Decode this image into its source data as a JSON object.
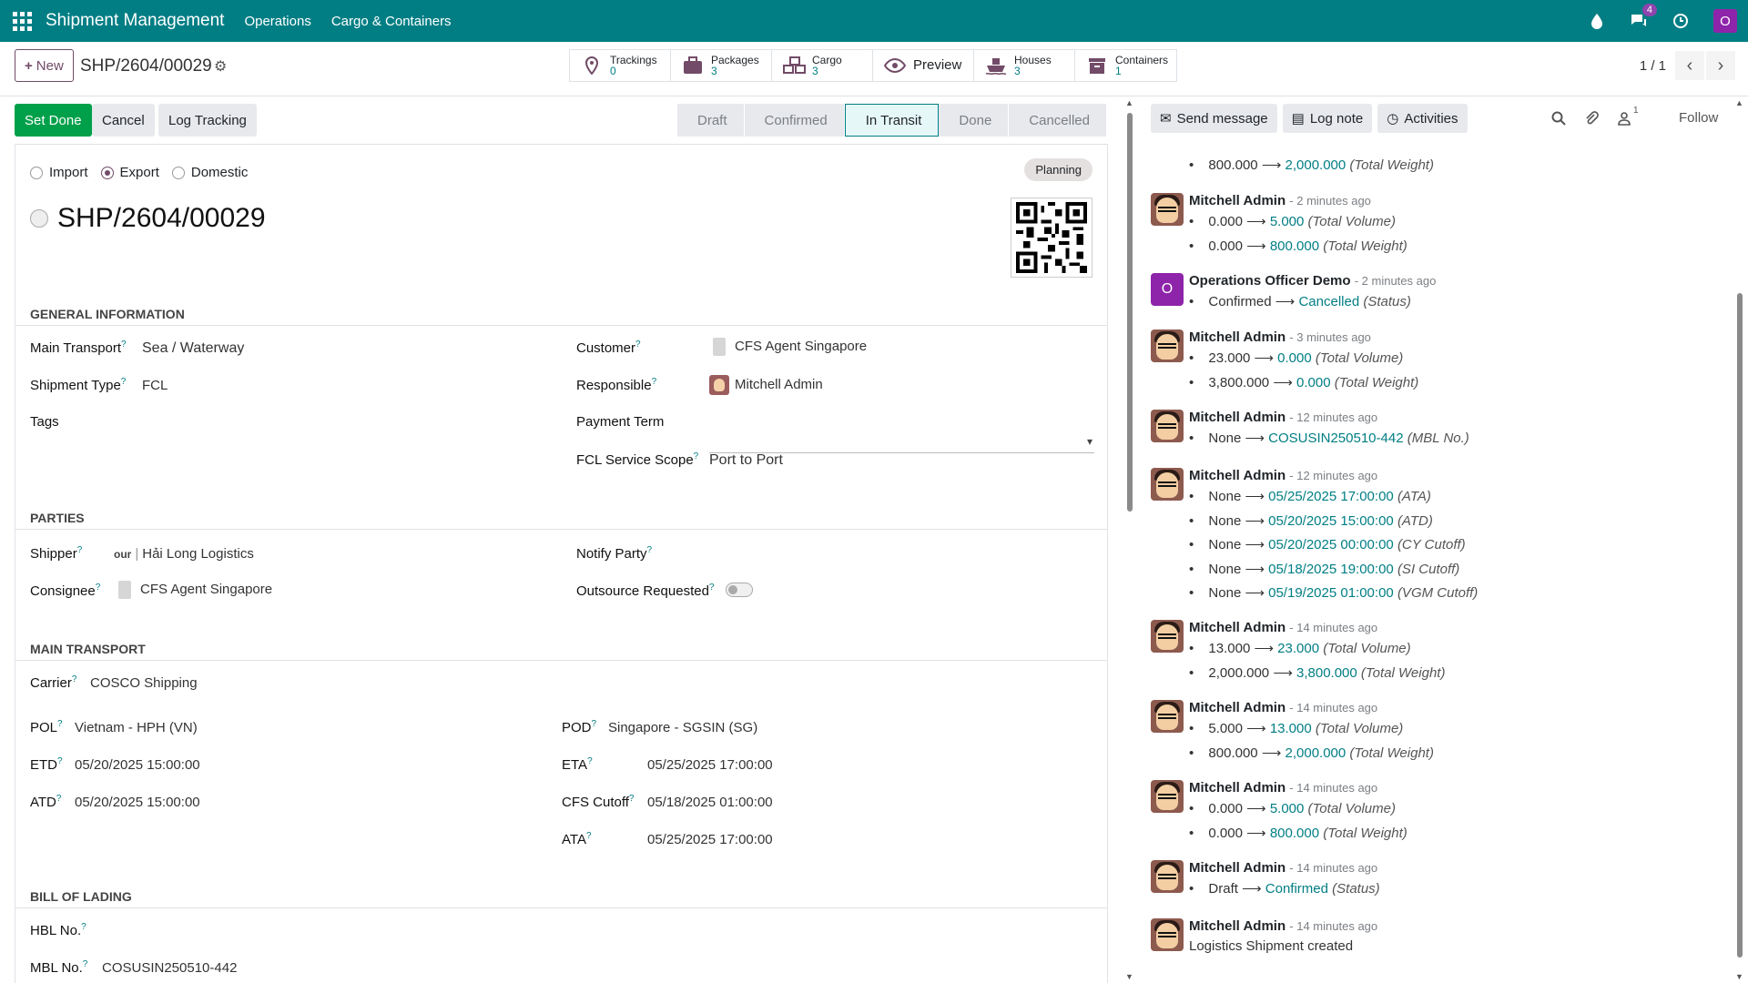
{
  "nav": {
    "brand": "Shipment Management",
    "menus": [
      "Operations",
      "Cargo & Containers"
    ],
    "chat_badge": "4",
    "user_initial": "O"
  },
  "control": {
    "new_label": "New",
    "record_name": "SHP/2604/00029",
    "smart_buttons": [
      {
        "label": "Trackings",
        "count": "0",
        "icon": "map-pin-icon"
      },
      {
        "label": "Packages",
        "count": "3",
        "icon": "package-icon"
      },
      {
        "label": "Cargo",
        "count": "3",
        "icon": "cargo-icon"
      },
      {
        "label": "Preview",
        "count": "",
        "icon": "eye-icon"
      },
      {
        "label": "Houses",
        "count": "3",
        "icon": "ship-icon"
      },
      {
        "label": "Containers",
        "count": "1",
        "icon": "container-icon"
      }
    ],
    "pager": "1 / 1"
  },
  "status": {
    "buttons": [
      "Set Done",
      "Cancel",
      "Log Tracking"
    ],
    "stages": [
      "Draft",
      "Confirmed",
      "In Transit",
      "Done",
      "Cancelled"
    ],
    "active_stage": "In Transit"
  },
  "form": {
    "direction": [
      "Import",
      "Export",
      "Domestic"
    ],
    "direction_selected": "Export",
    "state_badge": "Planning",
    "title": "SHP/2604/00029",
    "general": {
      "header": "GENERAL INFORMATION",
      "main_transport_label": "Main Transport",
      "main_transport": "Sea / Waterway",
      "shipment_type_label": "Shipment Type",
      "shipment_type": "FCL",
      "tags_label": "Tags",
      "customer_label": "Customer",
      "customer": "CFS Agent Singapore",
      "responsible_label": "Responsible",
      "responsible": "Mitchell Admin",
      "payment_term_label": "Payment Term",
      "fcl_scope_label": "FCL Service Scope",
      "fcl_scope": "Port to Port"
    },
    "parties": {
      "header": "PARTIES",
      "shipper_label": "Shipper",
      "shipper_logo": "our",
      "shipper": "Hải Long Logistics",
      "consignee_label": "Consignee",
      "consignee": "CFS Agent Singapore",
      "notify_label": "Notify Party",
      "outsource_label": "Outsource Requested"
    },
    "transport": {
      "header": "MAIN TRANSPORT",
      "carrier_label": "Carrier",
      "carrier": "COSCO Shipping",
      "pol_label": "POL",
      "pol": "Vietnam - HPH (VN)",
      "etd_label": "ETD",
      "etd": "05/20/2025 15:00:00",
      "atd_label": "ATD",
      "atd": "05/20/2025 15:00:00",
      "pod_label": "POD",
      "pod": "Singapore - SGSIN (SG)",
      "eta_label": "ETA",
      "eta": "05/25/2025 17:00:00",
      "cfs_label": "CFS Cutoff",
      "cfs": "05/18/2025 01:00:00",
      "ata_label": "ATA",
      "ata": "05/25/2025 17:00:00"
    },
    "bol": {
      "header": "BILL OF LADING",
      "hbl_label": "HBL No.",
      "mbl_label": "MBL No.",
      "mbl": "COSUSIN250510-442"
    }
  },
  "chatter": {
    "send_message": "Send message",
    "log_note": "Log note",
    "activities": "Activities",
    "followers_count": "1",
    "follow": "Follow",
    "top_partial": {
      "old": "800.000",
      "new": "2,000.000",
      "field": "(Total Weight)"
    },
    "messages": [
      {
        "author": "Mitchell Admin",
        "time": "- 2 minutes ago",
        "avatar": "mitchell",
        "changes": [
          {
            "old": "0.000",
            "new": "5.000",
            "field": "(Total Volume)"
          },
          {
            "old": "0.000",
            "new": "800.000",
            "field": "(Total Weight)"
          }
        ]
      },
      {
        "author": "Operations Officer Demo",
        "time": "- 2 minutes ago",
        "avatar": "O",
        "changes": [
          {
            "old": "Confirmed",
            "new": "Cancelled",
            "field": "(Status)"
          }
        ]
      },
      {
        "author": "Mitchell Admin",
        "time": "- 3 minutes ago",
        "avatar": "mitchell",
        "changes": [
          {
            "old": "23.000",
            "new": "0.000",
            "field": "(Total Volume)"
          },
          {
            "old": "3,800.000",
            "new": "0.000",
            "field": "(Total Weight)"
          }
        ]
      },
      {
        "author": "Mitchell Admin",
        "time": "- 12 minutes ago",
        "avatar": "mitchell",
        "changes": [
          {
            "old": "None",
            "new": "COSUSIN250510-442",
            "field": "(MBL No.)"
          }
        ]
      },
      {
        "author": "Mitchell Admin",
        "time": "- 12 minutes ago",
        "avatar": "mitchell",
        "changes": [
          {
            "old": "None",
            "new": "05/25/2025 17:00:00",
            "field": "(ATA)"
          },
          {
            "old": "None",
            "new": "05/20/2025 15:00:00",
            "field": "(ATD)"
          },
          {
            "old": "None",
            "new": "05/20/2025 00:00:00",
            "field": "(CY Cutoff)"
          },
          {
            "old": "None",
            "new": "05/18/2025 19:00:00",
            "field": "(SI Cutoff)"
          },
          {
            "old": "None",
            "new": "05/19/2025 01:00:00",
            "field": "(VGM Cutoff)"
          }
        ]
      },
      {
        "author": "Mitchell Admin",
        "time": "- 14 minutes ago",
        "avatar": "mitchell",
        "changes": [
          {
            "old": "13.000",
            "new": "23.000",
            "field": "(Total Volume)"
          },
          {
            "old": "2,000.000",
            "new": "3,800.000",
            "field": "(Total Weight)"
          }
        ]
      },
      {
        "author": "Mitchell Admin",
        "time": "- 14 minutes ago",
        "avatar": "mitchell",
        "changes": [
          {
            "old": "5.000",
            "new": "13.000",
            "field": "(Total Volume)"
          },
          {
            "old": "800.000",
            "new": "2,000.000",
            "field": "(Total Weight)"
          }
        ]
      },
      {
        "author": "Mitchell Admin",
        "time": "- 14 minutes ago",
        "avatar": "mitchell",
        "changes": [
          {
            "old": "0.000",
            "new": "5.000",
            "field": "(Total Volume)"
          },
          {
            "old": "0.000",
            "new": "800.000",
            "field": "(Total Weight)"
          }
        ]
      },
      {
        "author": "Mitchell Admin",
        "time": "- 14 minutes ago",
        "avatar": "mitchell",
        "changes": [
          {
            "old": "Draft",
            "new": "Confirmed",
            "field": "(Status)"
          }
        ]
      },
      {
        "author": "Mitchell Admin",
        "time": "- 14 minutes ago",
        "avatar": "mitchell",
        "body": "Logistics Shipment created"
      }
    ]
  }
}
